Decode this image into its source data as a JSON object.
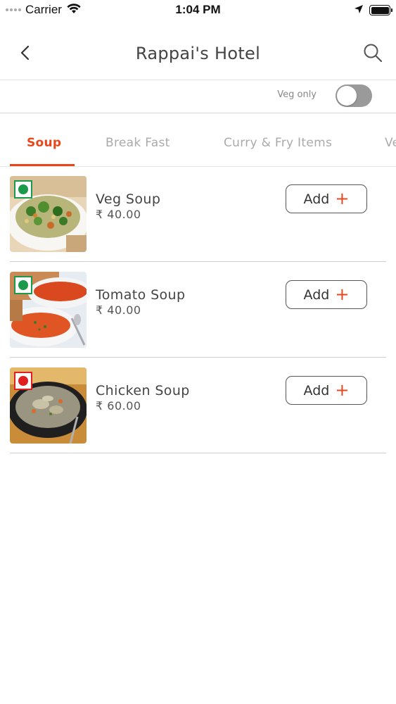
{
  "status_bar": {
    "carrier": "Carrier",
    "time": "1:04 PM",
    "icons": [
      "signal-icon",
      "wifi-icon",
      "location-arrow-icon",
      "battery-icon"
    ]
  },
  "header": {
    "title": "Rappai's Hotel",
    "back_icon": "chevron-left-icon",
    "search_icon": "search-icon"
  },
  "filter": {
    "veg_only_label": "Veg only",
    "veg_only_enabled": false
  },
  "tabs": [
    {
      "label": "Soup",
      "active": true
    },
    {
      "label": "Break Fast",
      "active": false
    },
    {
      "label": "Curry & Fry Items",
      "active": false
    },
    {
      "label": "Ve",
      "active": false
    }
  ],
  "menu": {
    "items": [
      {
        "name": "Veg Soup",
        "price": "₹ 40.00",
        "type": "veg",
        "add_label": "Add",
        "add_icon": "+"
      },
      {
        "name": "Tomato Soup",
        "price": "₹ 40.00",
        "type": "veg",
        "add_label": "Add",
        "add_icon": "+"
      },
      {
        "name": "Chicken Soup",
        "price": "₹ 60.00",
        "type": "non-veg",
        "add_label": "Add",
        "add_icon": "+"
      }
    ]
  },
  "colors": {
    "accent": "#e8471c",
    "veg_green": "#1a9a4a",
    "nonveg_red": "#e02020",
    "toggle_off": "#9a9a9a"
  }
}
